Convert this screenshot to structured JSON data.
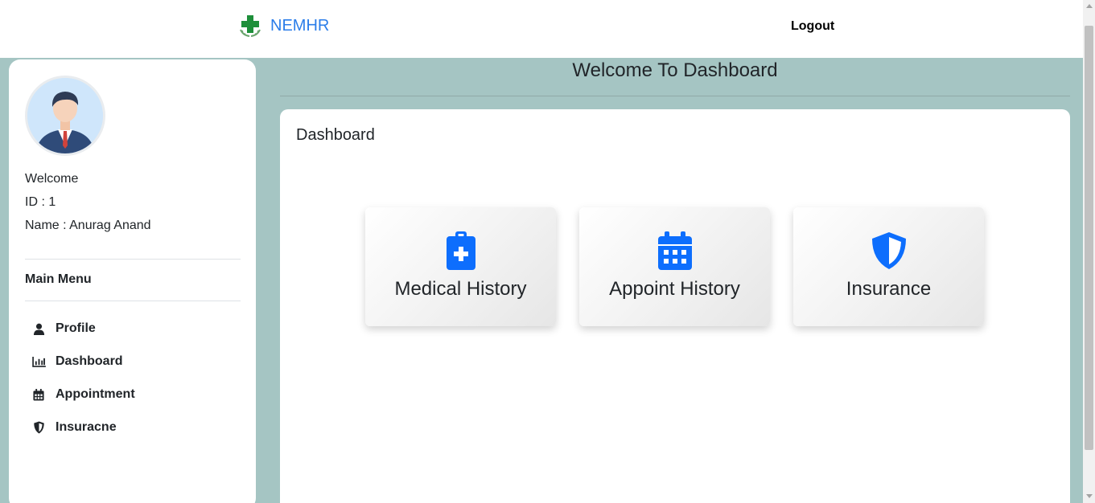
{
  "header": {
    "brand": "NEMHR",
    "logout": "Logout"
  },
  "sidebar": {
    "welcome": "Welcome",
    "id": "ID : 1",
    "name": "Name : Anurag Anand",
    "menu_title": "Main Menu",
    "items": [
      {
        "label": "Profile",
        "icon": "user-icon"
      },
      {
        "label": "Dashboard",
        "icon": "chart-bar-icon"
      },
      {
        "label": "Appointment",
        "icon": "calendar-icon"
      },
      {
        "label": "Insuracne",
        "icon": "shield-icon"
      }
    ]
  },
  "main": {
    "page_title": "Welcome To Dashboard",
    "panel_title": "Dashboard",
    "cards": [
      {
        "label": "Medical History",
        "icon": "clipboard-medical-icon"
      },
      {
        "label": "Appoint History",
        "icon": "calendar-icon"
      },
      {
        "label": "Insurance",
        "icon": "shield-icon"
      }
    ]
  },
  "colors": {
    "background": "#a5c5c3",
    "brand": "#2b7de9",
    "card_icon": "#0d6efd",
    "logo_cross": "#1e8f3a"
  }
}
